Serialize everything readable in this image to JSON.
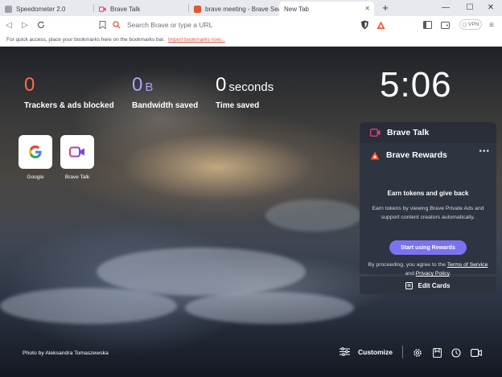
{
  "tabs": [
    {
      "title": "Speedometer 2.0",
      "favicon_color": "#8a8f98"
    },
    {
      "title": "Brave Talk",
      "favicon_color": "#e0407a"
    },
    {
      "title": "brave meeting - Brave Search",
      "favicon_color": "#e0582c"
    },
    {
      "title": "New Tab",
      "favicon_color": "#ffffff"
    }
  ],
  "toolbar": {
    "url_placeholder": "Search Brave or type a URL",
    "vpn_label": "VPN"
  },
  "bookmarks": {
    "message": "For quick access, place your bookmarks here on the bookmarks bar.",
    "import_link": "Import bookmarks now..."
  },
  "stats": {
    "trackers": {
      "value": "0",
      "label": "Trackers & ads blocked",
      "color": "#ff6d4a"
    },
    "bandwidth": {
      "value": "0",
      "unit": "B",
      "label": "Bandwidth saved",
      "color": "#a8a6ff"
    },
    "time": {
      "value": "0",
      "unit": "seconds",
      "label": "Time saved",
      "color": "#ffffff"
    }
  },
  "clock": "5:06",
  "top_sites": [
    {
      "label": "Google",
      "icon": "google-icon"
    },
    {
      "label": "Brave Talk",
      "icon": "brave-talk-icon"
    }
  ],
  "cards": {
    "talk": {
      "title": "Brave Talk"
    },
    "rewards": {
      "title": "Brave Rewards",
      "more": "•••",
      "headline": "Earn tokens and give back",
      "description": "Earn tokens by viewing Brave Private Ads and support content creators automatically.",
      "button": "Start using Rewards",
      "terms_prefix": "By proceeding, you agree to the ",
      "terms_link": "Terms of Service",
      "terms_and": " and ",
      "privacy_link": "Privacy Policy",
      "terms_suffix": "."
    },
    "edit": {
      "label": "Edit Cards"
    }
  },
  "footer": {
    "photo_credit": "Photo by Aleksandra Tomaszewska",
    "customize": "Customize"
  },
  "colors": {
    "accent": "#7b72f0",
    "brave_orange": "#fb542b",
    "talk_pink": "#e0407a"
  }
}
